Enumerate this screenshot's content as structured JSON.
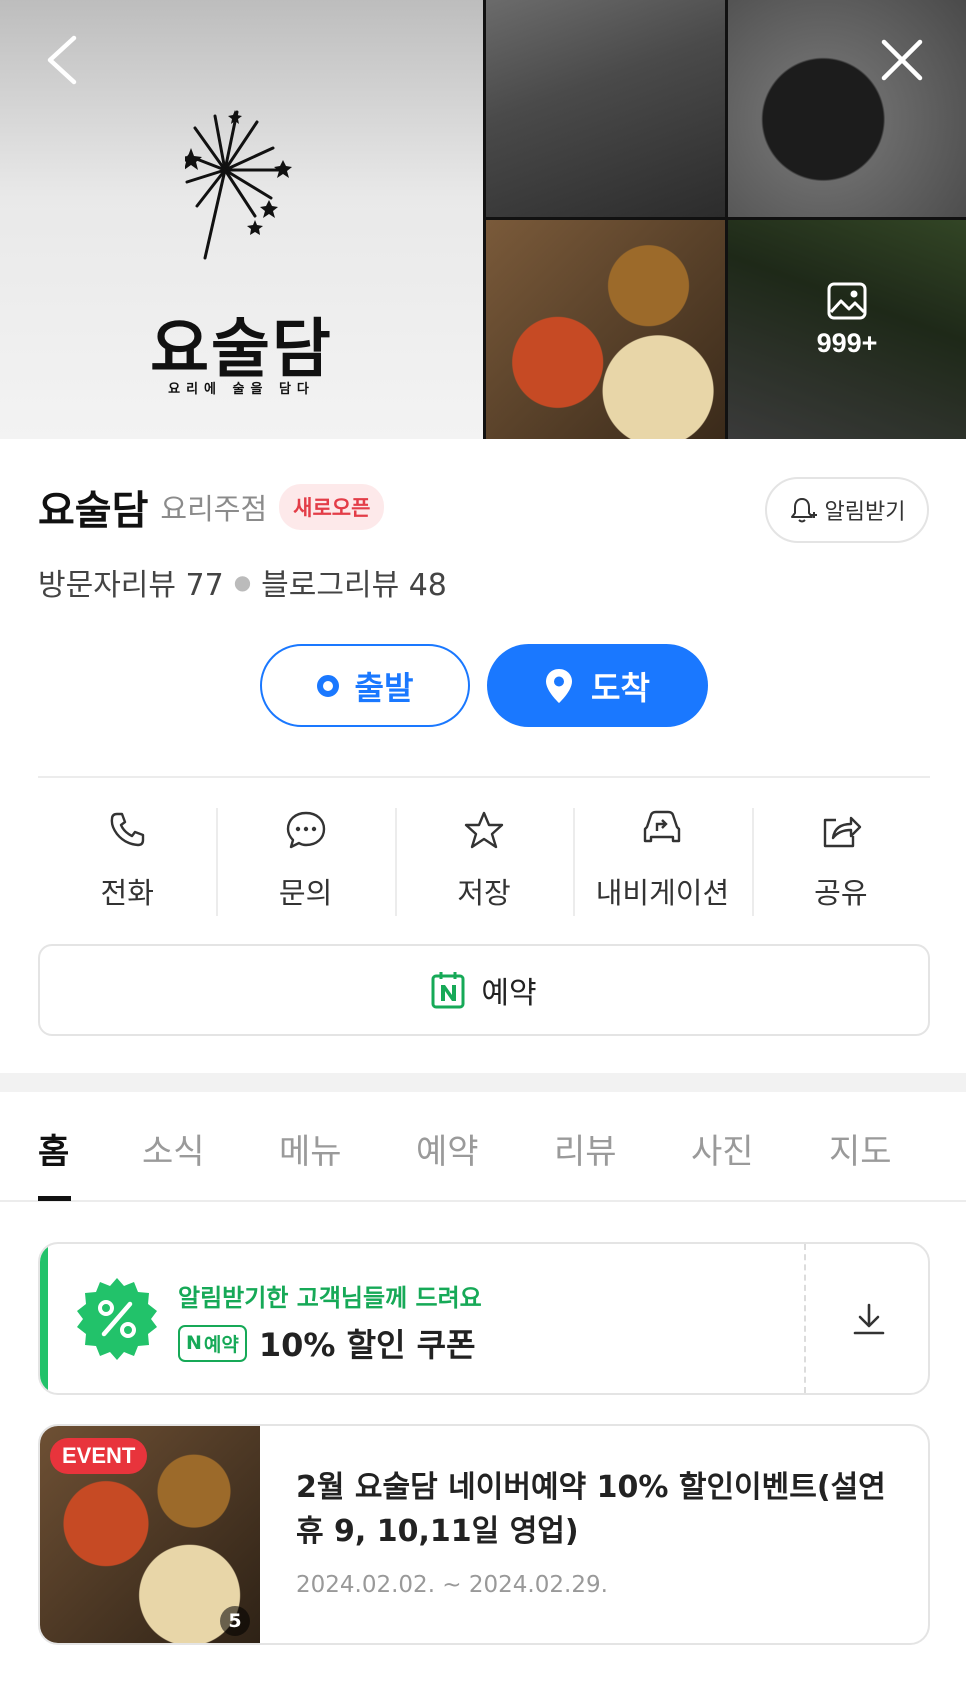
{
  "gallery": {
    "photo_count": "999+",
    "logo": {
      "name": "요술담",
      "tagline": "요리에 술을 담다"
    }
  },
  "place": {
    "name": "요술담",
    "category": "요리주점",
    "badge": "새로오픈",
    "notify_label": "알림받기",
    "visitor_reviews": "방문자리뷰 77",
    "blog_reviews": "블로그리뷰 48"
  },
  "route": {
    "depart_label": "출발",
    "arrive_label": "도착"
  },
  "actions": [
    {
      "label": "전화",
      "icon": "phone-icon"
    },
    {
      "label": "문의",
      "icon": "chat-icon"
    },
    {
      "label": "저장",
      "icon": "star-icon"
    },
    {
      "label": "내비게이션",
      "icon": "car-navigation-icon"
    },
    {
      "label": "공유",
      "icon": "share-icon"
    }
  ],
  "reserve": {
    "label": "예약"
  },
  "tabs": [
    "홈",
    "소식",
    "메뉴",
    "예약",
    "리뷰",
    "사진",
    "지도"
  ],
  "active_tab": "홈",
  "coupon": {
    "title": "알림받기한 고객님들께 드려요",
    "tag": "예약",
    "offer": "10% 할인 쿠폰"
  },
  "event": {
    "tag": "EVENT",
    "photo_count": "5",
    "title": "2월 요술담 네이버예약 10% 할인이벤트(설연휴 9, 10,11일 영업)",
    "date": "2024.02.02. ~ 2024.02.29."
  },
  "colors": {
    "primary_blue": "#1a78ff",
    "naver_green": "#16a957",
    "badge_red": "#e33d48",
    "event_red": "#e8343c"
  }
}
